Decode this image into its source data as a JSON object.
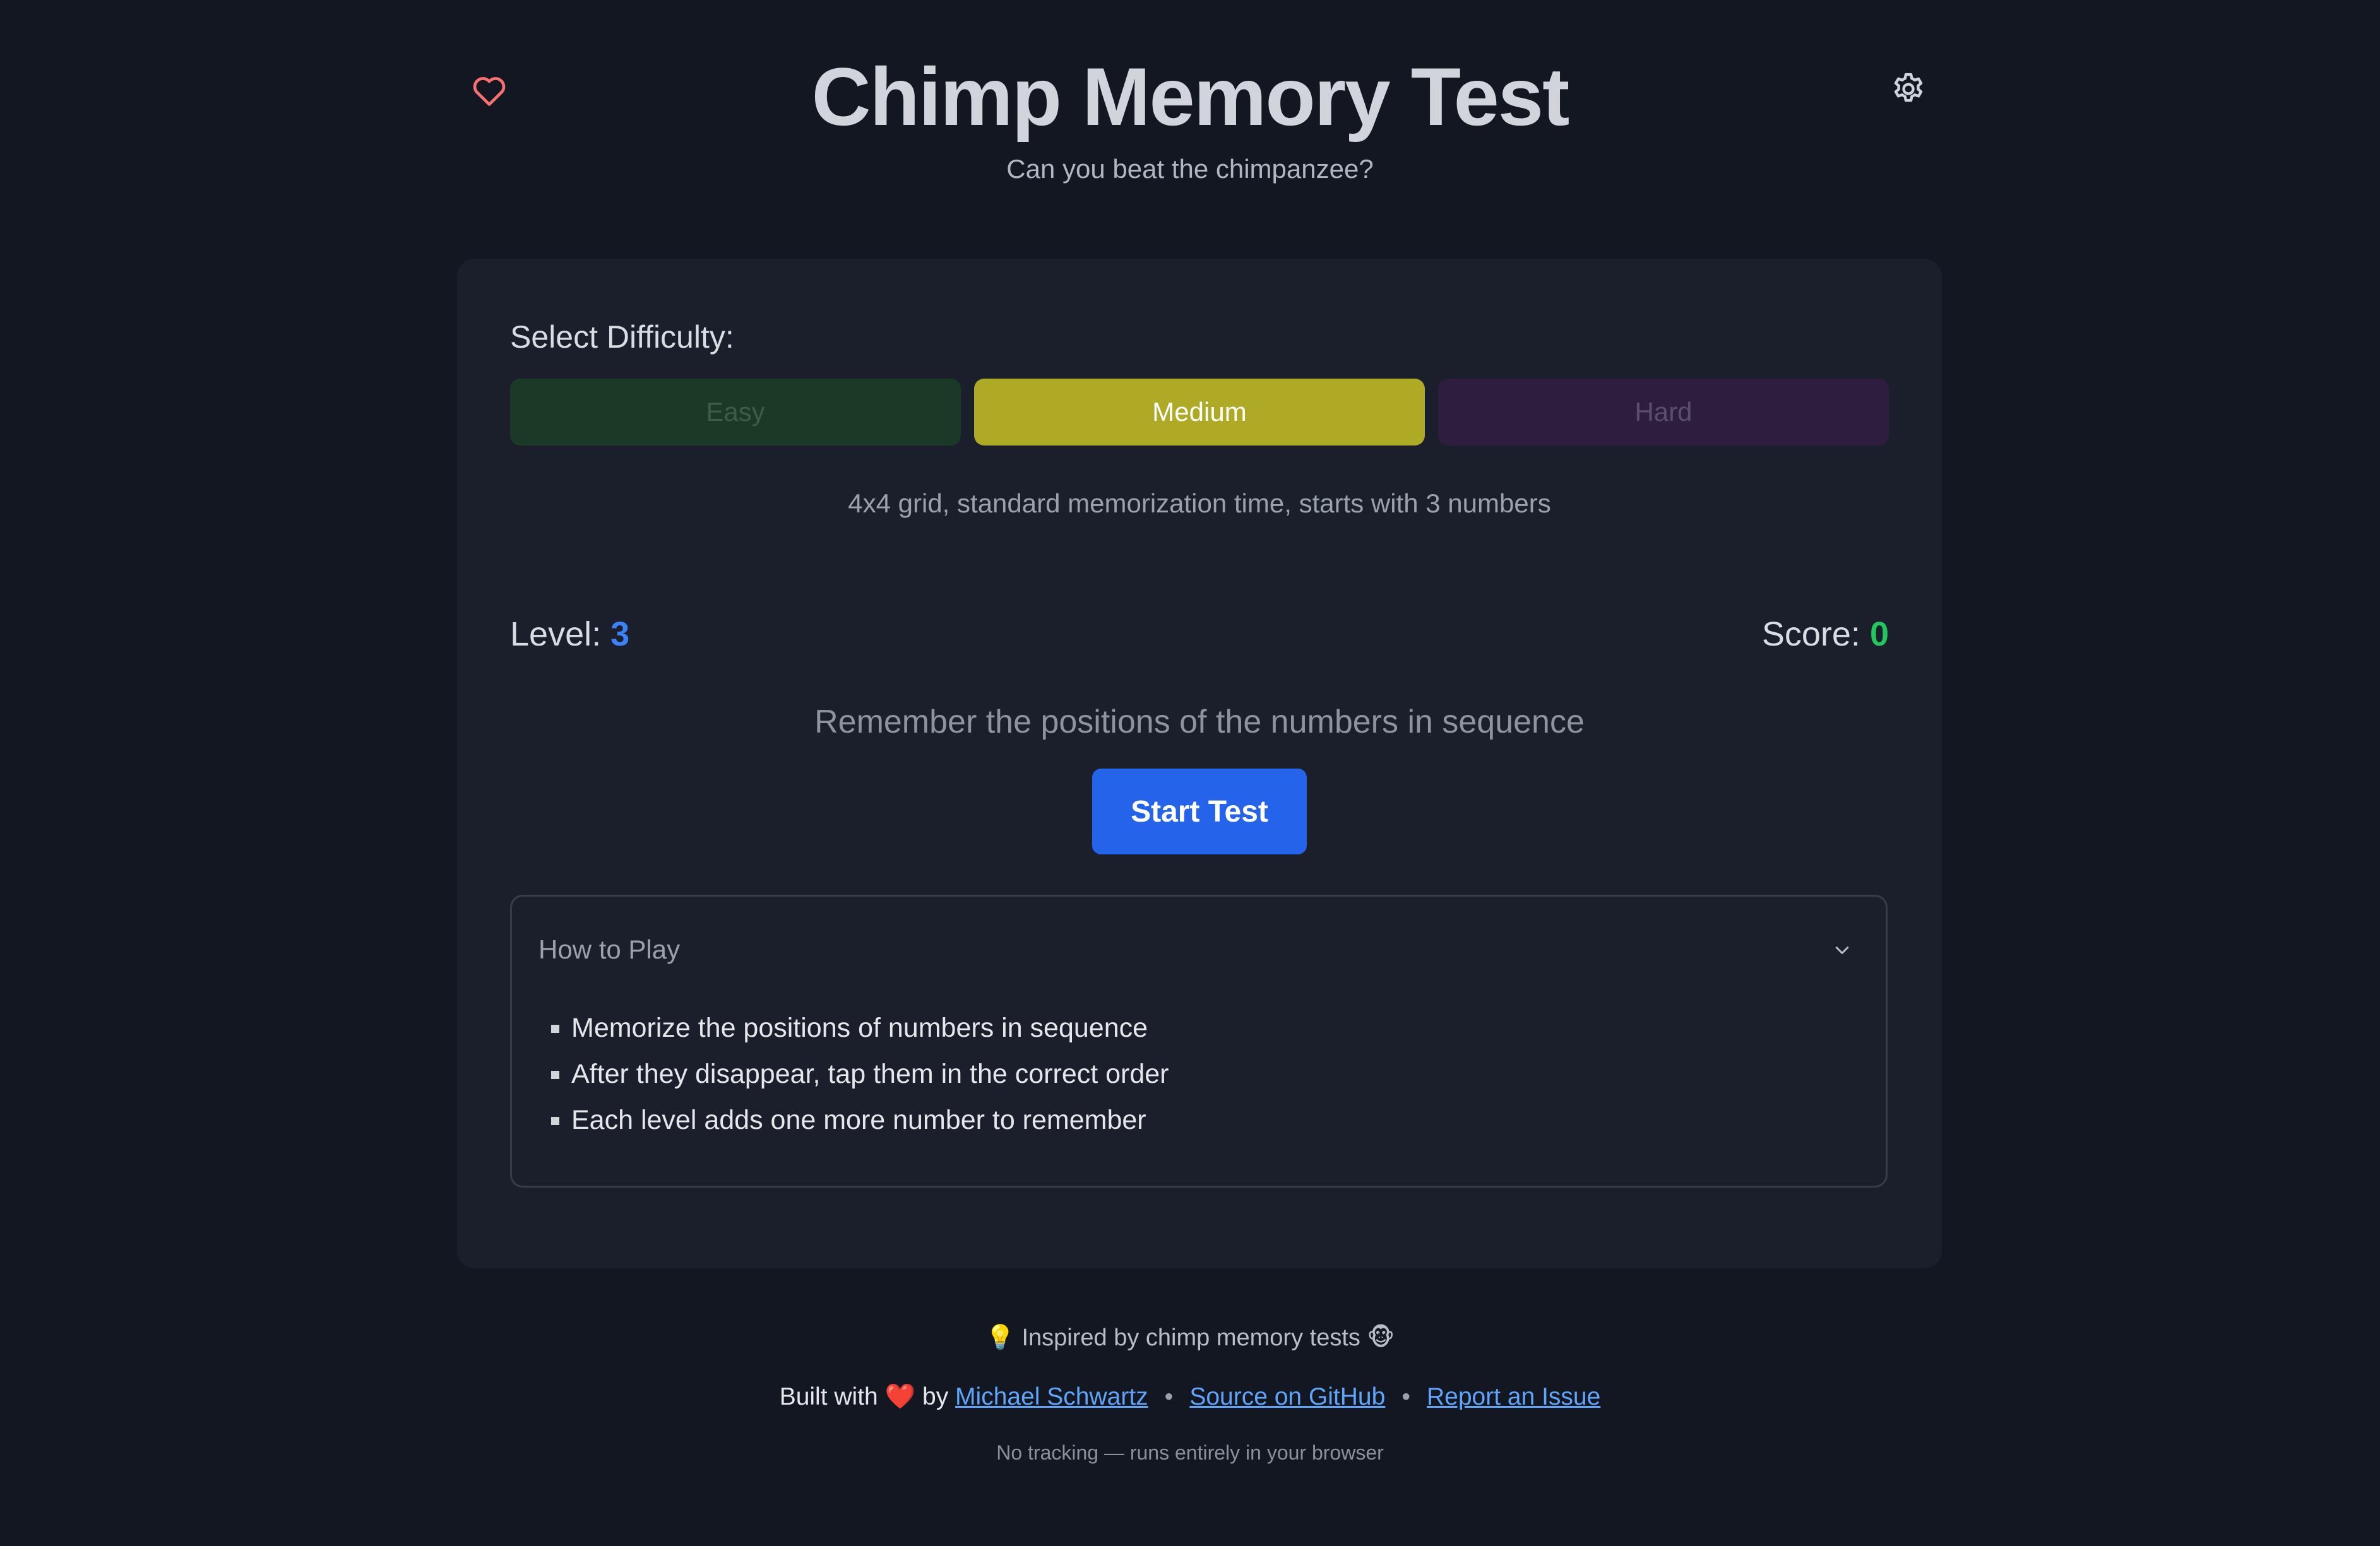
{
  "header": {
    "title": "Chimp Memory Test",
    "subtitle": "Can you beat the chimpanzee?",
    "icons": {
      "left": "heart-icon",
      "right": "gear-icon"
    }
  },
  "difficulty": {
    "label": "Select Difficulty:",
    "options": [
      "Easy",
      "Medium",
      "Hard"
    ],
    "selected": "Medium",
    "description": "4x4 grid, standard memorization time, starts with 3 numbers"
  },
  "stats": {
    "level_label": "Level:",
    "level_value": "3",
    "score_label": "Score:",
    "score_value": "0"
  },
  "game": {
    "instruction": "Remember the positions of the numbers in sequence",
    "start_label": "Start Test"
  },
  "how_to_play": {
    "title": "How to Play",
    "items": [
      "Memorize the positions of numbers in sequence",
      "After they disappear, tap them in the correct order",
      "Each level adds one more number to remember"
    ]
  },
  "footer": {
    "inspired": "💡 Inspired by chimp memory tests 🐵",
    "built_with": "Built with",
    "heart": "❤️",
    "by": "by",
    "author": "Michael Schwartz",
    "separator": "•",
    "source": "Source on GitHub",
    "issue": "Report an Issue",
    "privacy": "No tracking — runs entirely in your browser"
  },
  "colors": {
    "background": "#121722",
    "card": "#1a1f2b",
    "accent_blue": "#2563eb",
    "level_blue": "#3b82f6",
    "score_green": "#22c55e",
    "medium_yellow": "#aeaa25",
    "link": "#60a5fa",
    "heart": "#f87171"
  }
}
